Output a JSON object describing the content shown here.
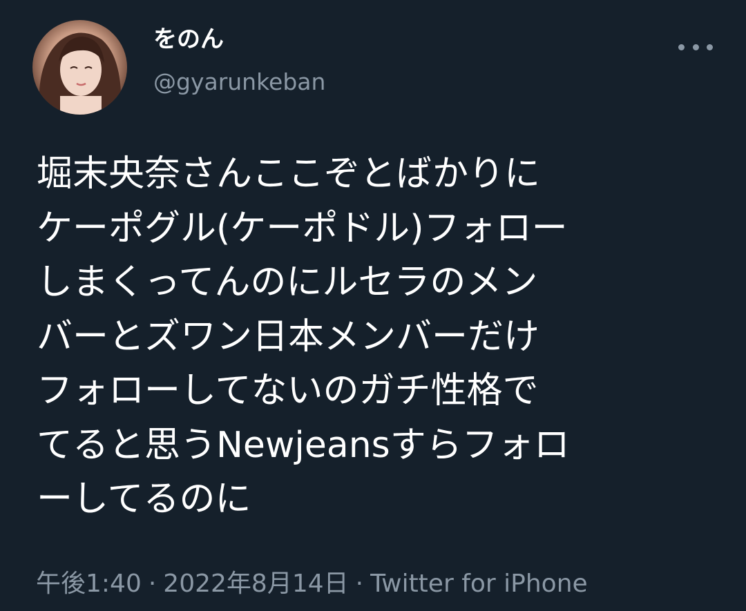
{
  "user": {
    "display_name": "をのん",
    "handle": "@gyarunkeban"
  },
  "more_icon": "more-horizontal-icon",
  "tweet": {
    "text": "堀末央奈さんここぞとばかりに\nケーポグル(ケーポドル)フォロー\nしまくってんのにルセラのメン\nバーとズワン日本メンバーだけ\nフォローしてないのガチ性格で\nてると思うNewjeansすらフォロ\nーしてるのに",
    "time": "午後1:40",
    "separator": "·",
    "date": "2022年8月14日",
    "source": "Twitter for iPhone"
  },
  "colors": {
    "background": "#15202b",
    "primary_text": "#ffffff",
    "secondary_text": "#8b98a5"
  }
}
